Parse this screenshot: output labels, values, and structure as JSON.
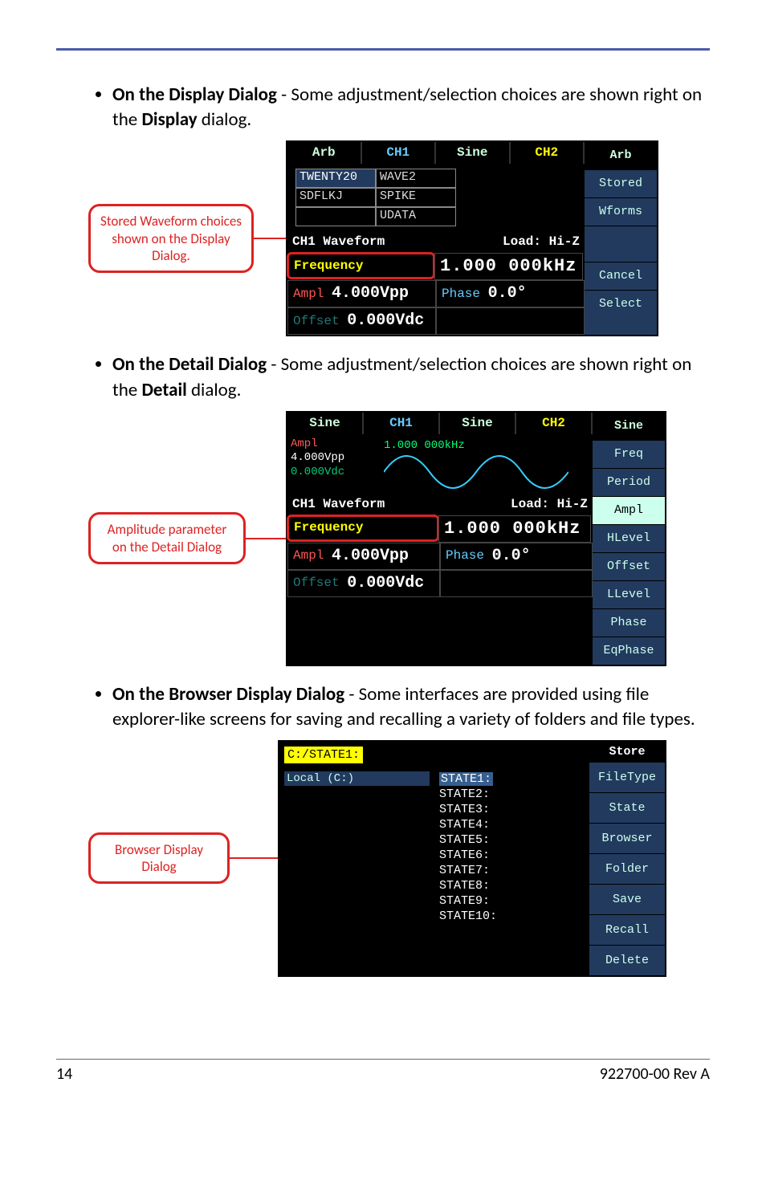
{
  "page": {
    "number": "14",
    "rev": "922700-00 Rev A"
  },
  "bullets": {
    "b1_bold": "On the Display Dialog",
    "b1_rest": " - Some adjustment/selection choices are shown right on the ",
    "b1_bold2": "Display",
    "b1_rest2": " dialog.",
    "b2_bold": "On the Detail Dialog",
    "b2_rest": " - Some adjustment/selection choices are shown right on the ",
    "b2_bold2": "Detail",
    "b2_rest2": " dialog.",
    "b3_bold": "On the Browser Display Dialog",
    "b3_rest": " - Some interfaces are provided using file explorer-like screens for saving and recalling a variety of folders and file types."
  },
  "callouts": {
    "c1": "Stored Waveform choices shown on the Display Dialog.",
    "c2": "Amplitude parameter on the Detail Dialog",
    "c3": "Browser Display Dialog"
  },
  "fig1": {
    "tabs": {
      "t1": "Arb",
      "t2": "CH1",
      "t3": "Sine",
      "t4": "CH2"
    },
    "side": {
      "title": "Arb",
      "sk1": "Stored",
      "sk2": "Wforms",
      "sk3": "Cancel",
      "sk4": "Select"
    },
    "table": {
      "a1": "TWENTY20",
      "a2": "WAVE2",
      "b1": "SDFLKJ",
      "b2": "SPIKE",
      "c1": "",
      "c2": "UDATA"
    },
    "sec": {
      "left": "CH1 Waveform",
      "right": "Load: Hi-Z"
    },
    "p": {
      "freqL": "Frequency",
      "freqV": "1.000 000kHz",
      "ampL": "Ampl",
      "ampV": "4.000Vpp",
      "phL": "Phase",
      "phV": "0.0°",
      "offL": "Offset",
      "offV": "0.000Vdc"
    }
  },
  "fig2": {
    "tabs": {
      "t1": "Sine",
      "t2": "CH1",
      "t3": "Sine",
      "t4": "CH2"
    },
    "side": {
      "title": "Sine",
      "sk1": "Freq",
      "sk2": "Period",
      "sk3": "Ampl",
      "sk4": "HLevel",
      "sk5": "Offset",
      "sk6": "LLevel",
      "sk7": "Phase",
      "sk8": "EqPhase"
    },
    "preview": {
      "ampl": "Ampl",
      "vpp": "4.000Vpp",
      "vdc": "0.000Vdc",
      "rate": "1.000 000kHz"
    },
    "sec": {
      "left": "CH1 Waveform",
      "right": "Load: Hi-Z"
    },
    "p": {
      "freqL": "Frequency",
      "freqV": "1.000 000kHz",
      "ampL": "Ampl",
      "ampV": "4.000Vpp",
      "phL": "Phase",
      "phV": "0.0°",
      "offL": "Offset",
      "offV": "0.000Vdc"
    }
  },
  "fig3": {
    "path": "C:/STATE1:",
    "drive": "Local (C:)",
    "states": [
      "STATE1:",
      "STATE2:",
      "STATE3:",
      "STATE4:",
      "STATE5:",
      "STATE6:",
      "STATE7:",
      "STATE8:",
      "STATE9:",
      "STATE10:"
    ],
    "side": {
      "title": "Store",
      "sk1": "FileType",
      "sk2": "State",
      "sk3": "Browser",
      "sk4": "Folder",
      "sk5": "Save",
      "sk6": "Recall",
      "sk7": "Delete"
    }
  }
}
